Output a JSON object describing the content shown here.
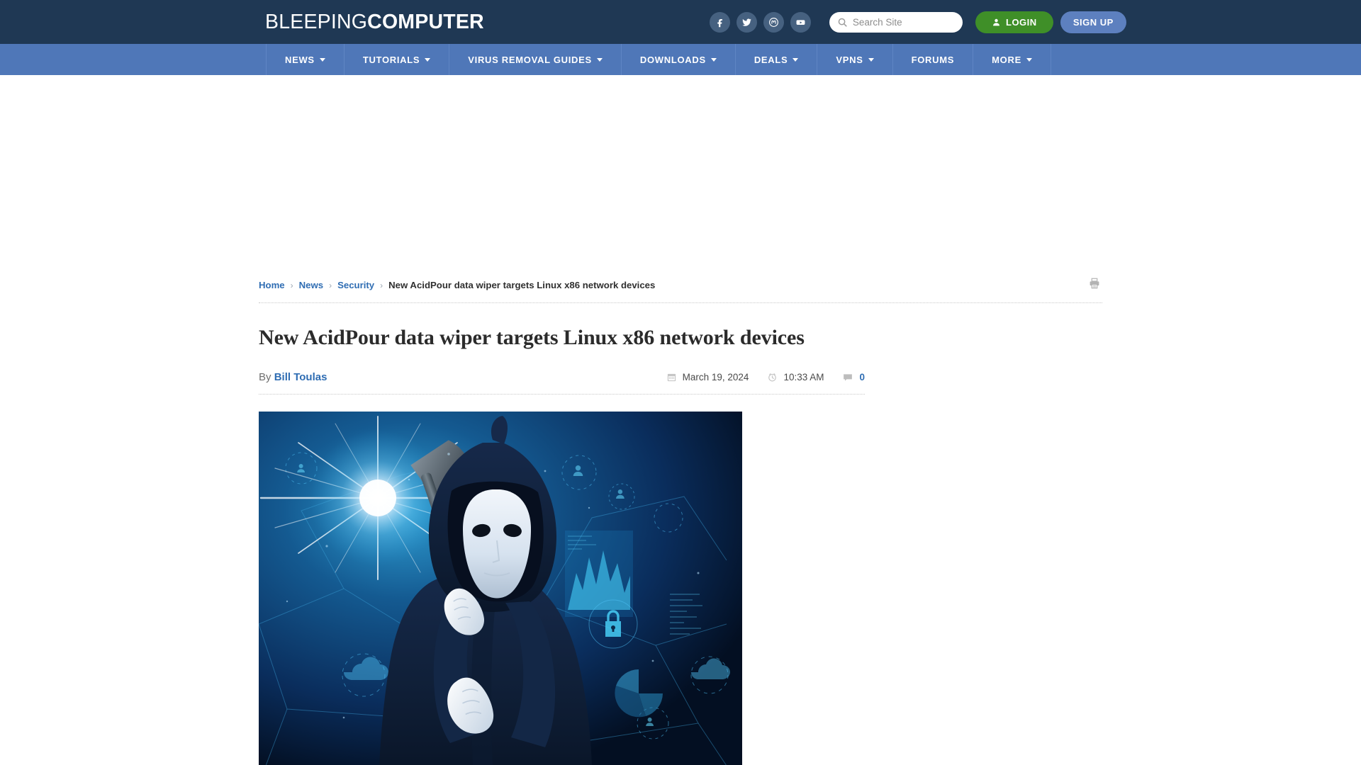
{
  "header": {
    "logo_thin": "BLEEPING",
    "logo_bold": "COMPUTER",
    "social": [
      {
        "name": "facebook-icon",
        "label": "Facebook"
      },
      {
        "name": "twitter-icon",
        "label": "Twitter"
      },
      {
        "name": "mastodon-icon",
        "label": "Mastodon"
      },
      {
        "name": "youtube-icon",
        "label": "YouTube"
      }
    ],
    "search": {
      "placeholder": "Search Site",
      "value": "",
      "icon": "search-icon"
    },
    "login_label": "LOGIN",
    "signup_label": "SIGN UP",
    "login_color": "#3f8f28",
    "signup_color": "#5d80bf",
    "background_color": "#1f3854"
  },
  "nav": {
    "background_color": "#4f77b8",
    "items": [
      {
        "label": "NEWS",
        "has_dropdown": true
      },
      {
        "label": "TUTORIALS",
        "has_dropdown": true
      },
      {
        "label": "VIRUS REMOVAL GUIDES",
        "has_dropdown": true
      },
      {
        "label": "DOWNLOADS",
        "has_dropdown": true
      },
      {
        "label": "DEALS",
        "has_dropdown": true
      },
      {
        "label": "VPNS",
        "has_dropdown": true
      },
      {
        "label": "FORUMS",
        "has_dropdown": false
      },
      {
        "label": "MORE",
        "has_dropdown": true
      }
    ]
  },
  "breadcrumb": {
    "items": [
      {
        "label": "Home",
        "link": true
      },
      {
        "label": "News",
        "link": true
      },
      {
        "label": "Security",
        "link": true
      },
      {
        "label": "New AcidPour data wiper targets Linux x86 network devices",
        "link": false
      }
    ],
    "separator": "›",
    "print_icon": "print-icon"
  },
  "article": {
    "title": "New AcidPour data wiper targets Linux x86 network devices",
    "byline_prefix": "By",
    "author": "Bill Toulas",
    "date": "March 19, 2024",
    "time": "10:33 AM",
    "comment_count": "0",
    "date_icon": "calendar-icon",
    "time_icon": "clock-icon",
    "comment_icon": "comment-icon",
    "hero_alt": "Hooded figure wearing white mask holding an axe over a blue cyber network background"
  }
}
